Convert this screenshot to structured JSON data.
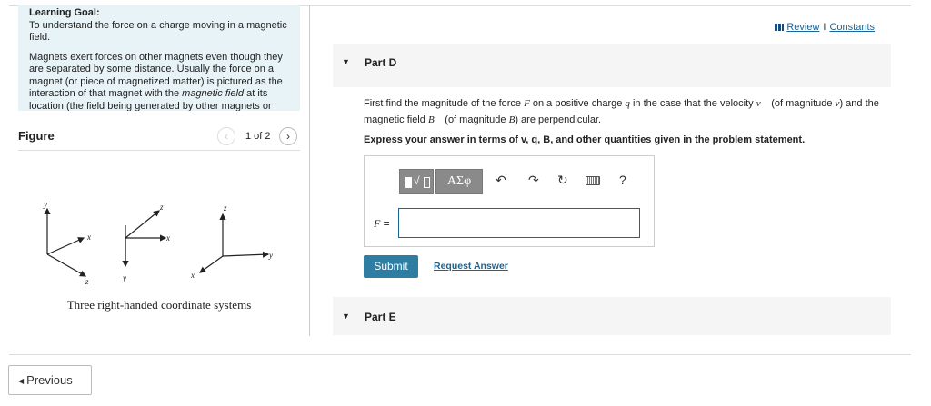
{
  "learning_goal": {
    "title": "Learning Goal:",
    "line1": "To understand the force on a charge moving in a magnetic field.",
    "para_a": "Magnets exert forces on other magnets even though they are separated by some distance. Usually the force on a magnet (or piece of magnetized matter) is pictured as the interaction of that magnet with the ",
    "para_em": "magnetic field",
    "para_b": " at its location (the field being generated by other magnets or"
  },
  "figure": {
    "title": "Figure",
    "page": "1 of 2",
    "caption": "Three right-handed coordinate systems",
    "axis_labels": {
      "sys1": [
        "y",
        "x",
        "z"
      ],
      "sys2": [
        "z",
        "x",
        "y"
      ],
      "sys3": [
        "z",
        "y",
        "x"
      ]
    }
  },
  "links": {
    "review": "Review",
    "separator": "I",
    "constants": "Constants"
  },
  "part_d": {
    "label": "Part D",
    "q_1": "First find the magnitude of the force ",
    "q_F": "F",
    "q_2": " on a positive charge ",
    "q_q": "q",
    "q_3": " in the case that the velocity ",
    "q_v": "v⃗",
    "q_4": " (of magnitude ",
    "q_v2": "v",
    "q_5": ") and the magnetic field ",
    "q_B": "B⃗",
    "q_6": " (of magnitude ",
    "q_B2": "B",
    "q_7": ") are perpendicular.",
    "instruction": "Express your answer in terms of v, q, B, and other quantities given in the problem statement.",
    "toolbar": {
      "greek": "ΑΣφ",
      "help": "?"
    },
    "answer_label": "F",
    "answer_eq": " =",
    "answer_value": "",
    "submit": "Submit",
    "request": "Request Answer"
  },
  "part_e": {
    "label": "Part E"
  },
  "footer": {
    "previous": "Previous"
  }
}
